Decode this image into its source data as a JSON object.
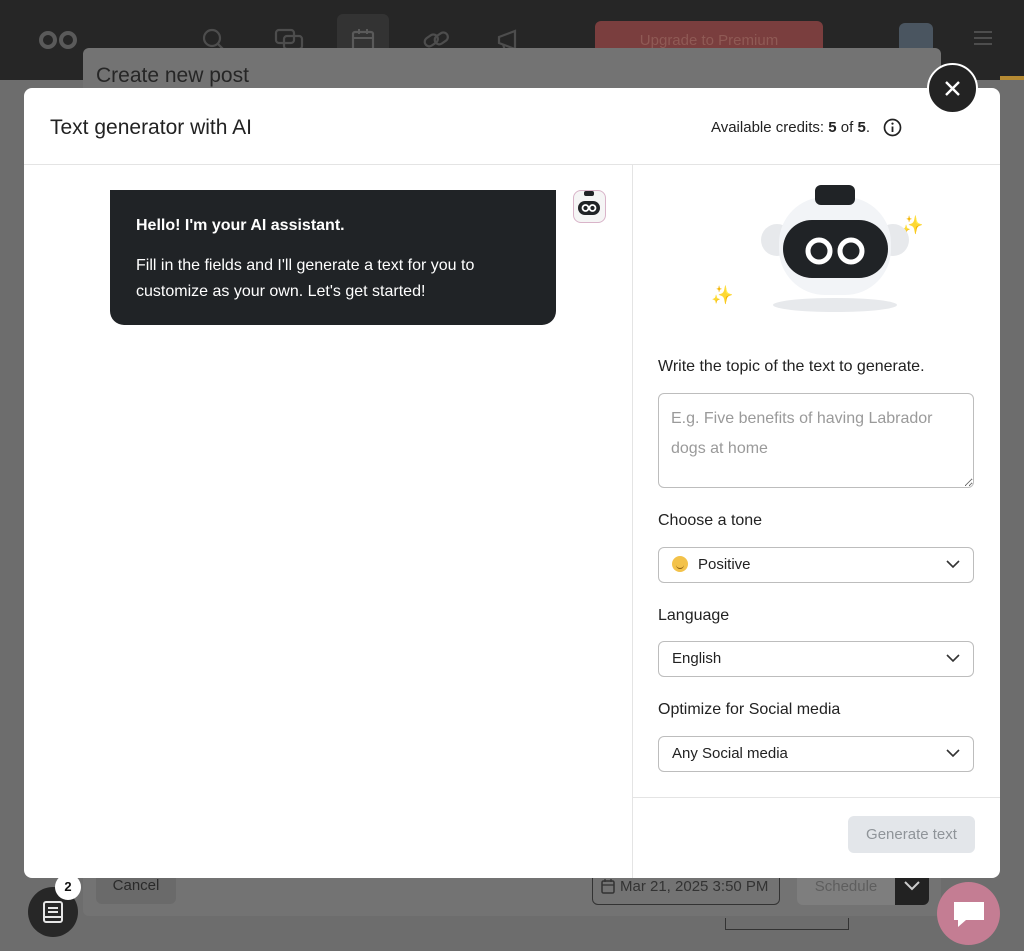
{
  "background": {
    "upgrade_label": "Upgrade to Premium",
    "create_post_title": "Create new post",
    "cancel_label": "Cancel",
    "date_value": "Mar 21, 2025 3:50 PM",
    "schedule_label": "Schedule",
    "notes_badge_count": "2"
  },
  "modal": {
    "title": "Text generator with AI",
    "credits_prefix": "Available credits:",
    "credits_used": "5",
    "credits_of": "of",
    "credits_total": "5",
    "credits_suffix": "."
  },
  "chat": {
    "greeting_title": "Hello! I'm your AI assistant.",
    "greeting_text": "Fill in the fields and I'll generate a text for you to customize as your own. Let's get started!"
  },
  "form": {
    "topic_label": "Write the topic of the text to generate.",
    "topic_placeholder": "E.g. Five benefits of having Labrador dogs at home",
    "topic_value": "",
    "tone_label": "Choose a tone",
    "tone_value": "Positive",
    "language_label": "Language",
    "language_value": "English",
    "social_label": "Optimize for Social media",
    "social_value": "Any Social media",
    "generate_label": "Generate text"
  },
  "icons": {
    "close": "close-icon",
    "info": "info-icon",
    "chevron": "chevron-down-icon",
    "tone_emoji": "smiley-emoji-icon"
  }
}
